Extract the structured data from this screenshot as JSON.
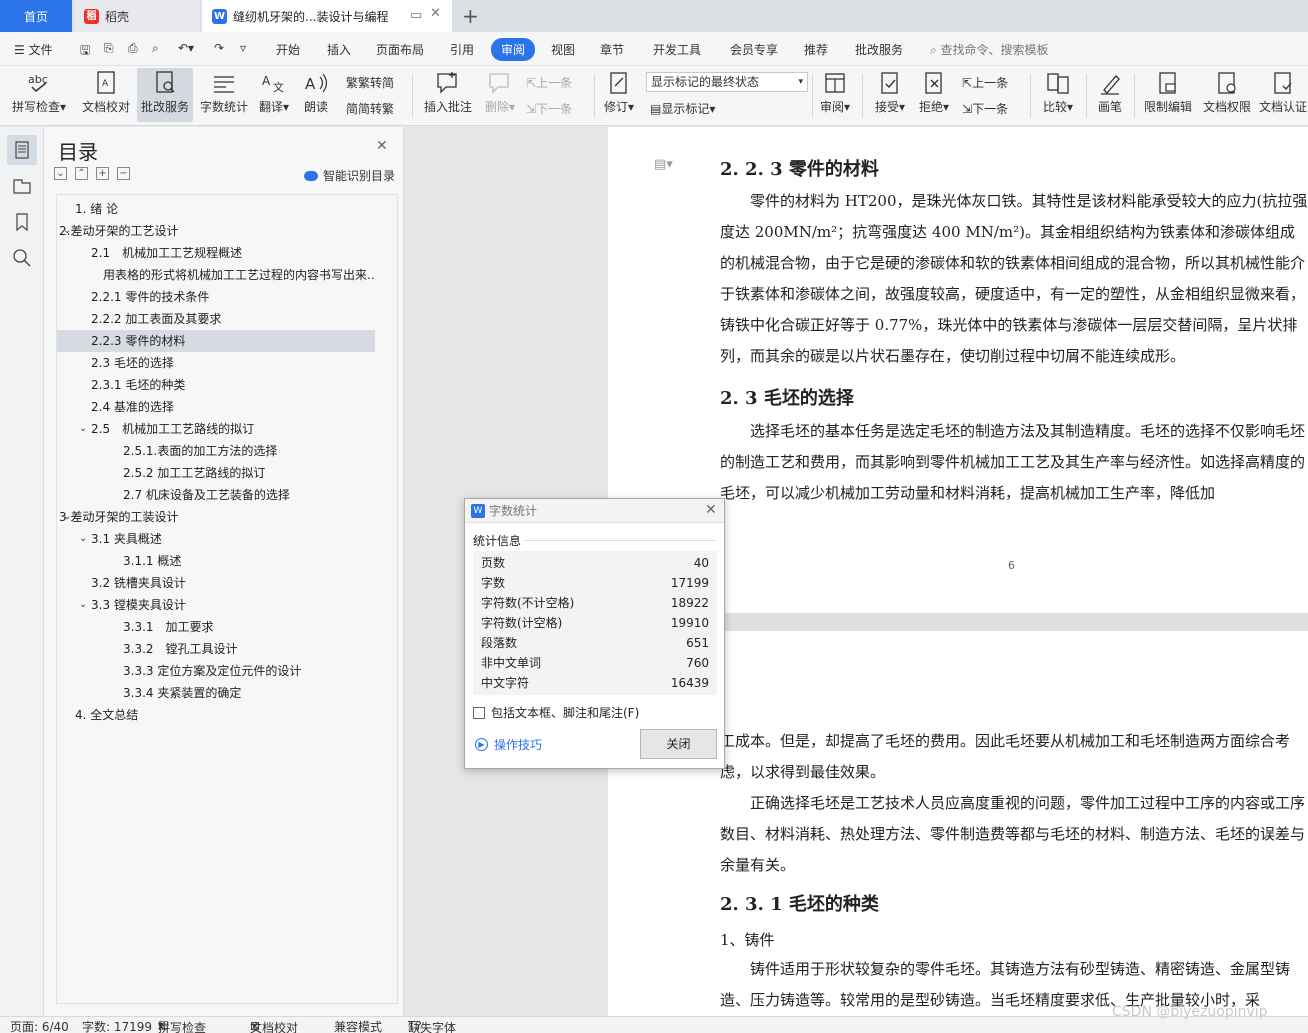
{
  "tabs": {
    "home": "首页",
    "daoke": "稻壳",
    "doc": "缝纫机牙架的...装设计与编程"
  },
  "menu": {
    "file": "文件",
    "items": [
      "开始",
      "插入",
      "页面布局",
      "引用",
      "审阅",
      "视图",
      "章节",
      "开发工具",
      "会员专享",
      "推荐",
      "批改服务"
    ],
    "active": "审阅",
    "search_placeholder": "查找命令、搜索模板"
  },
  "ribbon": {
    "spell": "拼写检查",
    "proof": "文档校对",
    "grade": "批改服务",
    "wordcount": "字数统计",
    "translate": "翻译",
    "read": "朗读",
    "to_trad": "繁转简",
    "to_simp": "简转繁",
    "insert_comment": "插入批注",
    "delete": "删除",
    "prev": "上一条",
    "next": "下一条",
    "revise": "修订",
    "markup_select": "显示标记的最终状态",
    "show_markup": "显示标记",
    "review": "审阅",
    "accept": "接受",
    "reject": "拒绝",
    "prev2": "上一条",
    "next2": "下一条",
    "compare": "比较",
    "pen": "画笔",
    "restrict": "限制编辑",
    "rights": "文档权限",
    "certify": "文档认证"
  },
  "toc": {
    "title": "目录",
    "smart": "智能识别目录",
    "items": [
      "1. 绪 论",
      "2.差动牙架的工艺设计",
      "2.1　机械加工工艺规程概述",
      "用表格的形式将机械加工工艺过程的内容书写出来...",
      "2.2.1  零件的技术条件",
      "2.2.2  加工表面及其要求",
      "2.2.3 零件的材料",
      "2.3 毛坯的选择",
      "2.3.1 毛坯的种类",
      "2.4  基准的选择",
      "2.5　机械加工工艺路线的拟订",
      "2.5.1.表面的加工方法的选择",
      "2.5.2 加工工艺路线的拟订",
      "2.7 机床设备及工艺装备的选择",
      "3  差动牙架的工装设计",
      "3.1  夹具概述",
      "3.1.1  概述",
      "3.2  铣槽夹具设计",
      "3.3 镗模夹具设计",
      "3.3.1　加工要求",
      "3.3.2　镗孔工具设计",
      "3.3.3 定位方案及定位元件的设计",
      "3.3.4 夹紧装置的确定",
      "4.  全文总结"
    ]
  },
  "doc": {
    "h1": "2. 2. 3 零件的材料",
    "p1": "　　零件的材料为 HT200，是珠光体灰口铁。其特性是该材料能承受较大的应力(抗拉强度达 200MN/m²；抗弯强度达 400 MN/m²)。其金相组织结构为铁素体和渗碳体组成的机械混合物，由于它是硬的渗碳体和软的铁素体相间组成的混合物，所以其机械性能介于铁素体和渗碳体之间，故强度较高，硬度适中，有一定的塑性，从金相组织显微来看，铸铁中化合碳正好等于 0.77%，珠光体中的铁素体与渗碳体一层层交替间隔，呈片状排列，而其余的碳是以片状石墨存在，使切削过程中切屑不能连续成形。",
    "h2": "2. 3 毛坯的选择",
    "p2": "　　选择毛坯的基本任务是选定毛坯的制造方法及其制造精度。毛坯的选择不仅影响毛坯的制造工艺和费用，而其影响到零件机械加工工艺及其生产率与经济性。如选择高精度的毛坯，可以减少机械加工劳动量和材料消耗，提高机械加工生产率，降低加",
    "page_number": "6",
    "p3": "工成本。但是，却提高了毛坯的费用。因此毛坯要从机械加工和毛坯制造两方面综合考虑，以求得到最佳效果。",
    "p4": "　　正确选择毛坯是工艺技术人员应高度重视的问题，零件加工过程中工序的内容或工序数目、材料消耗、热处理方法、零件制造费等都与毛坯的材料、制造方法、毛坯的误差与余量有关。",
    "h3": "2. 3. 1 毛坯的种类",
    "p5": "1、铸件",
    "p6": "　　铸件适用于形状较复杂的零件毛坯。其铸造方法有砂型铸造、精密铸造、金属型铸造、压力铸造等。较常用的是型砂铸造。当毛坯精度要求低、生产批量较小时，采"
  },
  "dialog": {
    "title": "字数统计",
    "section": "统计信息",
    "rows": [
      {
        "k": "页数",
        "v": "40"
      },
      {
        "k": "字数",
        "v": "17199"
      },
      {
        "k": "字符数(不计空格)",
        "v": "18922"
      },
      {
        "k": "字符数(计空格)",
        "v": "19910"
      },
      {
        "k": "段落数",
        "v": "651"
      },
      {
        "k": "非中文单词",
        "v": "760"
      },
      {
        "k": "中文字符",
        "v": "16439"
      }
    ],
    "include": "包括文本框、脚注和尾注(F)",
    "tips": "操作技巧",
    "close": "关闭"
  },
  "status": {
    "page": "页面: 6/40",
    "words": "字数: 17199",
    "spell": "拼写检查",
    "proof": "文档校对",
    "compat": "兼容模式",
    "missing_font": "缺失字体"
  },
  "watermark": "CSDN @biyezuopinvip",
  "colors": {
    "accent": "#2a73e8",
    "wps_red": "#e8332e"
  }
}
